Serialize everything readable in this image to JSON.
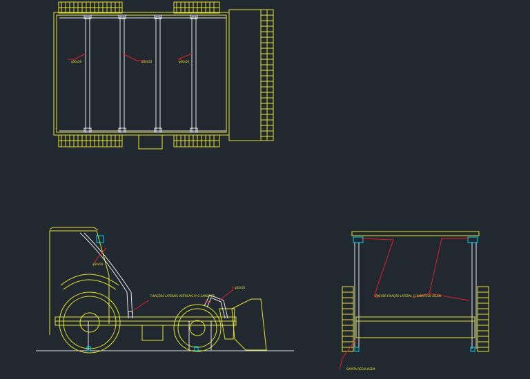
{
  "colors": {
    "background": "#212830",
    "yellow": "#e6e62e",
    "white": "#e8e8e8",
    "red": "#e0202a",
    "cyan": "#00d8ff"
  },
  "annotations": {
    "top_view_1": "φ50x50",
    "top_view_2": "φ50x50",
    "top_view_3": "φ50x50",
    "side_roll_bar": "φ50x50",
    "side_fixation": "FIXAÇÕES LATERAIS VERTICAIS P/ O CANOPIES",
    "side_bucket": "φ50x50",
    "front_fixation": "PREVER FIXAÇÃO LATERAL C/ PARAFUSO ALLEN",
    "front_base": "SAPATA REGULAGEM"
  }
}
